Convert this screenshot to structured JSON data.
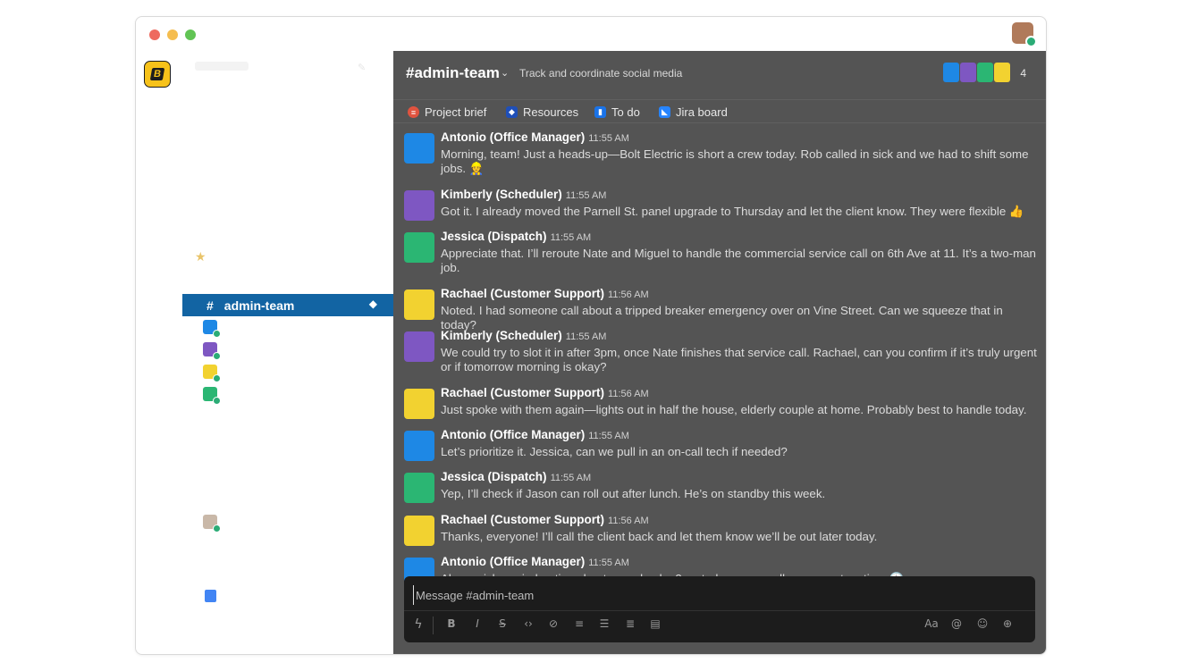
{
  "window": {
    "traffic_lights": [
      "#ee6a5f",
      "#f5bd4f",
      "#61c454"
    ],
    "user_status": "online"
  },
  "workspace": {
    "logo_letter": "B",
    "logo_color": "#f7c21a"
  },
  "sidebar": {
    "active_channel": {
      "prefix": "#",
      "name": "admin-team",
      "highlight": "#1264a3"
    },
    "starred_icon": "star-icon",
    "dm_avatars": [
      "antonio",
      "kimberly",
      "rachael",
      "jessica"
    ],
    "app_icons": [
      "person-avatar",
      "calendar-icon"
    ]
  },
  "header": {
    "channel_name": "#admin-team",
    "topic": "Track and coordinate social media",
    "member_count": "4"
  },
  "bookmarks": [
    {
      "label": "Project brief",
      "icon": "document-icon",
      "color": "#e0533f"
    },
    {
      "label": "Resources",
      "icon": "dropbox-icon",
      "color": "#1f4fb8"
    },
    {
      "label": "To do",
      "icon": "trello-icon",
      "color": "#1a73e8"
    },
    {
      "label": "Jira board",
      "icon": "jira-icon",
      "color": "#2684ff"
    }
  ],
  "messages": [
    {
      "author": "Antonio (Office Manager)",
      "time": "11:55 AM",
      "text": "Morning, team! Just a heads-up—Bolt Electric is short a crew today. Rob called in sick and we had to shift some jobs. 👷",
      "avatar_color": "#1e88e5"
    },
    {
      "author": "Kimberly (Scheduler)",
      "time": "11:55 AM",
      "text": "Got it. I already moved the Parnell St. panel upgrade to Thursday and let the client know. They were flexible 👍",
      "avatar_color": "#7e57c2"
    },
    {
      "author": "Jessica (Dispatch)",
      "time": "11:55 AM",
      "text": "Appreciate that. I’ll reroute Nate and Miguel to handle the commercial service call on 6th Ave at 11. It’s a two-man job.",
      "avatar_color": "#2bb673"
    },
    {
      "author": "Rachael (Customer Support)",
      "time": "11:56 AM",
      "text": "Noted. I had someone call about a tripped breaker emergency over on Vine Street. Can we squeeze that in today?",
      "avatar_color": "#f2d230"
    },
    {
      "author": "Kimberly (Scheduler)",
      "time": "11:55 AM",
      "text": "We could try to slot it in after 3pm, once Nate finishes that service call. Rachael, can you confirm if it’s truly urgent or if tomorrow morning is okay?",
      "avatar_color": "#7e57c2"
    },
    {
      "author": "Rachael (Customer Support)",
      "time": "11:56 AM",
      "text": "Just spoke with them again—lights out in half the house, elderly couple at home. Probably best to handle today.",
      "avatar_color": "#f2d230"
    },
    {
      "author": "Antonio (Office Manager)",
      "time": "11:55 AM",
      "text": "Let’s prioritize it. Jessica, can we pull in an on-call tech if needed?",
      "avatar_color": "#1e88e5"
    },
    {
      "author": "Jessica (Dispatch)",
      "time": "11:55 AM",
      "text": "Yep, I’ll check if Jason can roll out after lunch. He’s on standby this week.",
      "avatar_color": "#2bb673"
    },
    {
      "author": "Rachael (Customer Support)",
      "time": "11:56 AM",
      "text": "Thanks, everyone! I’ll call the client back and let them know we’ll be out later today.",
      "avatar_color": "#f2d230"
    },
    {
      "author": "Antonio (Office Manager)",
      "time": "11:55 AM",
      "text": "Also, quick reminder: timesheets are due by 3pm today so payroll can go out on time 🕐",
      "avatar_color": "#1e88e5"
    }
  ],
  "composer": {
    "placeholder": "Message #admin-team",
    "toolbar": [
      "shortcuts-icon",
      "bold-icon",
      "italic-icon",
      "strikethrough-icon",
      "code-icon",
      "link-icon",
      "ordered-list-icon",
      "bulleted-list-icon",
      "numbered-list-icon",
      "code-block-icon",
      "formatting-icon",
      "mention-icon",
      "emoji-icon",
      "attach-icon"
    ]
  }
}
